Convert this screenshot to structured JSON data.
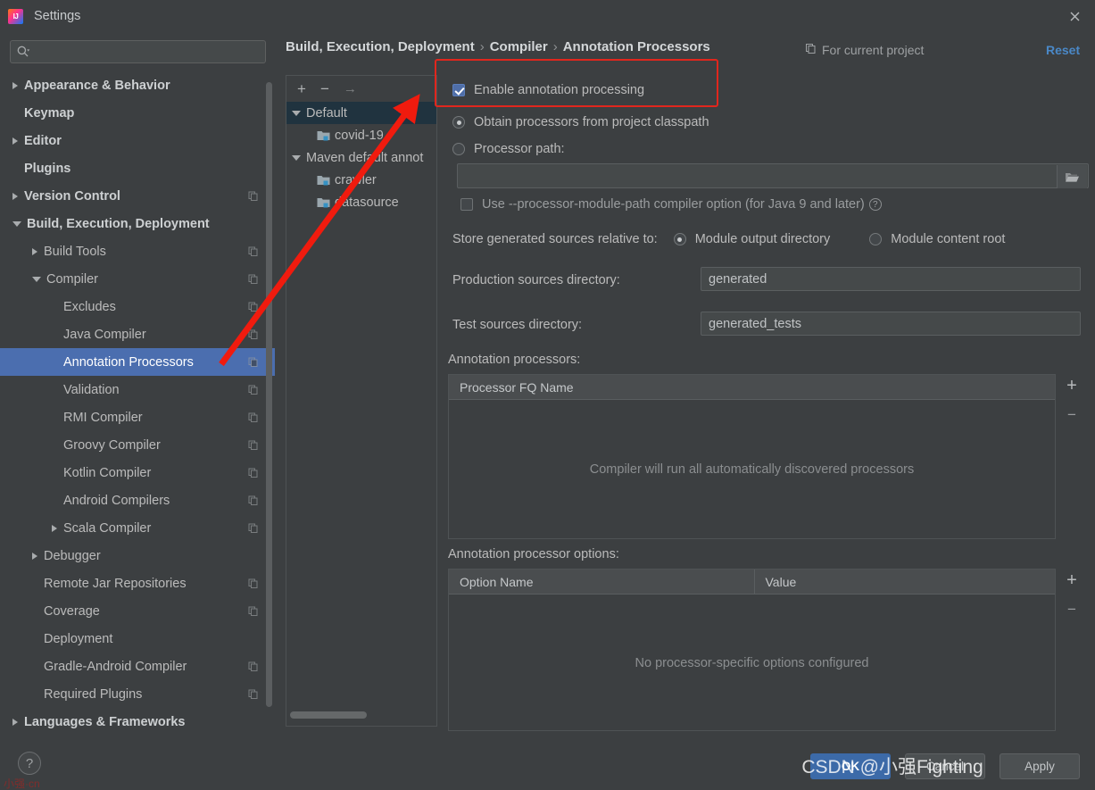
{
  "window": {
    "title": "Settings",
    "logo_icon": "intellij-idea-logo",
    "close_icon": "close-icon"
  },
  "search": {
    "value": "",
    "placeholder": "",
    "icon": "search-icon"
  },
  "sidebar": {
    "scrollbar": "sidebar-scrollbar",
    "items": [
      {
        "label": "Appearance & Behavior",
        "indent": 0,
        "twisty": "closed",
        "bold": true,
        "selected": false,
        "badge": false
      },
      {
        "label": "Keymap",
        "indent": 0,
        "twisty": "none",
        "bold": true,
        "selected": false,
        "badge": false
      },
      {
        "label": "Editor",
        "indent": 0,
        "twisty": "closed",
        "bold": true,
        "selected": false,
        "badge": false
      },
      {
        "label": "Plugins",
        "indent": 0,
        "twisty": "none",
        "bold": true,
        "selected": false,
        "badge": false
      },
      {
        "label": "Version Control",
        "indent": 0,
        "twisty": "closed",
        "bold": true,
        "selected": false,
        "badge": true
      },
      {
        "label": "Build, Execution, Deployment",
        "indent": 0,
        "twisty": "open",
        "bold": true,
        "selected": false,
        "badge": false
      },
      {
        "label": "Build Tools",
        "indent": 1,
        "twisty": "closed",
        "bold": false,
        "selected": false,
        "badge": true
      },
      {
        "label": "Compiler",
        "indent": 1,
        "twisty": "open",
        "bold": false,
        "selected": false,
        "badge": true
      },
      {
        "label": "Excludes",
        "indent": 2,
        "twisty": "none",
        "bold": false,
        "selected": false,
        "badge": true
      },
      {
        "label": "Java Compiler",
        "indent": 2,
        "twisty": "none",
        "bold": false,
        "selected": false,
        "badge": true
      },
      {
        "label": "Annotation Processors",
        "indent": 2,
        "twisty": "none",
        "bold": false,
        "selected": true,
        "badge": true
      },
      {
        "label": "Validation",
        "indent": 2,
        "twisty": "none",
        "bold": false,
        "selected": false,
        "badge": true
      },
      {
        "label": "RMI Compiler",
        "indent": 2,
        "twisty": "none",
        "bold": false,
        "selected": false,
        "badge": true
      },
      {
        "label": "Groovy Compiler",
        "indent": 2,
        "twisty": "none",
        "bold": false,
        "selected": false,
        "badge": true
      },
      {
        "label": "Kotlin Compiler",
        "indent": 2,
        "twisty": "none",
        "bold": false,
        "selected": false,
        "badge": true
      },
      {
        "label": "Android Compilers",
        "indent": 2,
        "twisty": "none",
        "bold": false,
        "selected": false,
        "badge": true
      },
      {
        "label": "Scala Compiler",
        "indent": 2,
        "twisty": "closed",
        "bold": false,
        "selected": false,
        "badge": true
      },
      {
        "label": "Debugger",
        "indent": 1,
        "twisty": "closed",
        "bold": false,
        "selected": false,
        "badge": false
      },
      {
        "label": "Remote Jar Repositories",
        "indent": 1,
        "twisty": "none",
        "bold": false,
        "selected": false,
        "badge": true
      },
      {
        "label": "Coverage",
        "indent": 1,
        "twisty": "none",
        "bold": false,
        "selected": false,
        "badge": true
      },
      {
        "label": "Deployment",
        "indent": 1,
        "twisty": "none",
        "bold": false,
        "selected": false,
        "badge": false
      },
      {
        "label": "Gradle-Android Compiler",
        "indent": 1,
        "twisty": "none",
        "bold": false,
        "selected": false,
        "badge": true
      },
      {
        "label": "Required Plugins",
        "indent": 1,
        "twisty": "none",
        "bold": false,
        "selected": false,
        "badge": true
      },
      {
        "label": "Languages & Frameworks",
        "indent": 0,
        "twisty": "closed",
        "bold": true,
        "selected": false,
        "badge": false
      }
    ]
  },
  "header": {
    "breadcrumb": [
      "Build, Execution, Deployment",
      "Compiler",
      "Annotation Processors"
    ],
    "separator": "›",
    "for_current_project": "For current project",
    "for_current_project_icon": "copy-scope-icon",
    "reset_label": "Reset"
  },
  "module_panel": {
    "toolbar": {
      "add_icon": "+",
      "remove_icon": "−",
      "move_icon": "→"
    },
    "rows": [
      {
        "label": "Default",
        "type": "profile",
        "selected": true,
        "indent": 0
      },
      {
        "label": "covid-19",
        "type": "module",
        "selected": false,
        "indent": 1
      },
      {
        "label": "Maven default annot",
        "type": "profile",
        "selected": false,
        "indent": 0
      },
      {
        "label": "crawler",
        "type": "module",
        "selected": false,
        "indent": 1
      },
      {
        "label": "datasource",
        "type": "module",
        "selected": false,
        "indent": 1
      }
    ]
  },
  "main": {
    "enable_annotation_processing": {
      "label": "Enable annotation processing",
      "checked": true
    },
    "source_radio_group": {
      "obtain_from_classpath": "Obtain processors from project classpath",
      "processor_path": "Processor path:",
      "selected": "obtain_from_classpath"
    },
    "processor_path_field": {
      "value": "",
      "browse_icon": "folder-browse-icon"
    },
    "processor_module_path": {
      "label": "Use --processor-module-path compiler option (for Java 9 and later)",
      "checked": false,
      "help_icon": "help-question-icon"
    },
    "store_generated": {
      "label": "Store generated sources relative to:",
      "option_module_output": "Module output directory",
      "option_module_content_root": "Module content root",
      "selected": "module_output"
    },
    "production_sources": {
      "label": "Production sources directory:",
      "value": "generated"
    },
    "test_sources": {
      "label": "Test sources directory:",
      "value": "generated_tests"
    },
    "annotation_processors": {
      "label": "Annotation processors:",
      "columns": [
        "Processor FQ Name"
      ],
      "rows": [],
      "empty_text": "Compiler will run all automatically discovered processors",
      "add_icon": "+",
      "remove_icon": "−"
    },
    "annotation_processor_options": {
      "label": "Annotation processor options:",
      "columns": [
        "Option Name",
        "Value"
      ],
      "rows": [],
      "empty_text": "No processor-specific options configured",
      "add_icon": "+",
      "remove_icon": "−"
    }
  },
  "footer": {
    "help_icon": "?",
    "ok_label": "OK",
    "cancel_label": "Cancel",
    "apply_label": "Apply"
  },
  "overlay": {
    "watermark": "CSDN @小强Fighting",
    "watermark_red": "小强·cn",
    "highlight_color": "#e1261d",
    "arrow_color": "#f01b0e"
  }
}
